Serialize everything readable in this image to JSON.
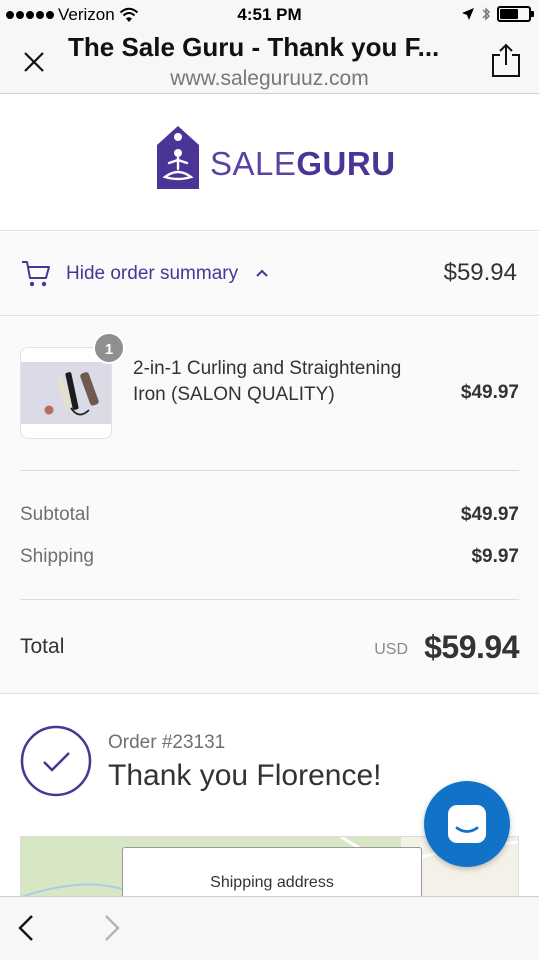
{
  "status_bar": {
    "carrier": "Verizon",
    "time": "4:51 PM"
  },
  "browser": {
    "title": "The Sale Guru - Thank you F...",
    "url": "www.saleguruuz.com"
  },
  "logo": {
    "text_light": "SALE",
    "text_bold": "GURU",
    "color": "#5b43a6"
  },
  "summary_toggle": {
    "label": "Hide order summary",
    "total": "$59.94"
  },
  "product": {
    "quantity": "1",
    "name": "2-in-1 Curling and Straightening Iron (SALON QUALITY)",
    "price": "$49.97"
  },
  "totals": {
    "subtotal_label": "Subtotal",
    "subtotal_value": "$49.97",
    "shipping_label": "Shipping",
    "shipping_value": "$9.97",
    "total_label": "Total",
    "currency": "USD",
    "total_value": "$59.94"
  },
  "confirmation": {
    "order_number": "Order #23131",
    "thank_you": "Thank you Florence!"
  },
  "map": {
    "address_label": "Shipping address"
  },
  "icons": {
    "close": "close-icon",
    "share": "share-icon",
    "cart": "cart-icon",
    "chevron": "chevron-up-icon",
    "check": "check-icon",
    "chat": "chat-icon",
    "back": "back-arrow-icon",
    "forward": "forward-arrow-icon"
  },
  "colors": {
    "accent": "#4a3596",
    "chat_button": "#1173c7"
  }
}
